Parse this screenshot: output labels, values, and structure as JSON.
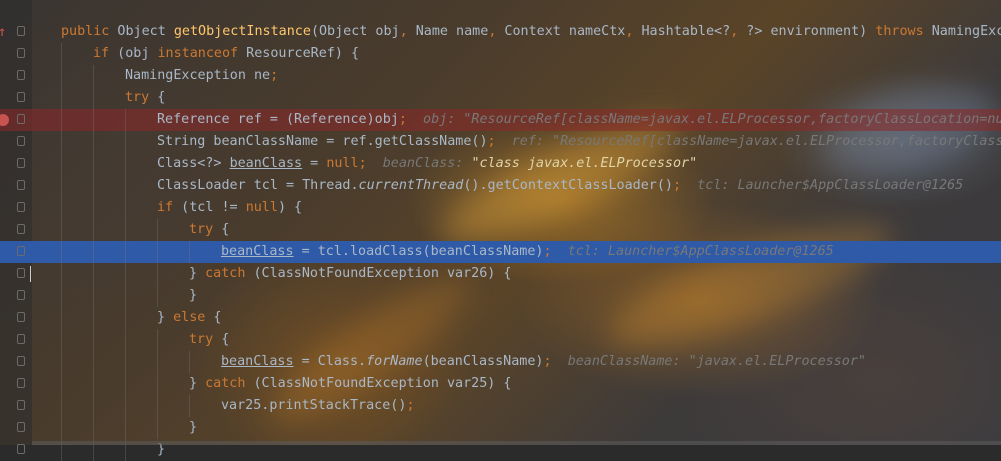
{
  "editor": {
    "lines": [
      {
        "indent": 0,
        "segments": [
          [
            "kw",
            "public"
          ],
          [
            "t",
            " Object "
          ],
          [
            "fn",
            "getObjectInstance"
          ],
          [
            "t",
            "(Object obj"
          ],
          [
            "kw",
            ","
          ],
          [
            "t",
            " Name name"
          ],
          [
            "kw",
            ","
          ],
          [
            "t",
            " Context nameCtx"
          ],
          [
            "kw",
            ","
          ],
          [
            "t",
            " Hashtable<?"
          ],
          [
            "kw",
            ","
          ],
          [
            "t",
            " ?> environment) "
          ],
          [
            "kw",
            "throws"
          ],
          [
            "t",
            " NamingExce"
          ]
        ]
      },
      {
        "indent": 1,
        "segments": [
          [
            "kw",
            "if"
          ],
          [
            "t",
            " (obj "
          ],
          [
            "kw",
            "instanceof"
          ],
          [
            "t",
            " ResourceRef) {"
          ]
        ]
      },
      {
        "indent": 2,
        "segments": [
          [
            "t",
            "NamingException ne"
          ],
          [
            "kw",
            ";"
          ]
        ]
      },
      {
        "indent": 2,
        "segments": [
          [
            "kw",
            "try"
          ],
          [
            "t",
            " {"
          ]
        ]
      },
      {
        "indent": 3,
        "segments": [
          [
            "t",
            "Reference ref = (Reference)obj"
          ],
          [
            "kw",
            ";"
          ],
          [
            "t",
            "  "
          ],
          [
            "hint",
            "obj: \"ResourceRef[className=javax.el.ELProcessor,factoryClassLocation=nu"
          ]
        ]
      },
      {
        "indent": 3,
        "segments": [
          [
            "t",
            "String beanClassName = ref.getClassName()"
          ],
          [
            "kw",
            ";"
          ],
          [
            "t",
            "  "
          ],
          [
            "hint",
            "ref: \"ResourceRef[className=javax.el.ELProcessor,factoryClass"
          ]
        ]
      },
      {
        "indent": 3,
        "segments": [
          [
            "t",
            "Class<?> "
          ],
          [
            "ul",
            "beanClass"
          ],
          [
            "t",
            " = "
          ],
          [
            "kw",
            "null"
          ],
          [
            "kw",
            ";"
          ],
          [
            "t",
            "  "
          ],
          [
            "hint",
            "beanClass: "
          ],
          [
            "str",
            "\"class javax.el.ELProcessor\""
          ]
        ]
      },
      {
        "indent": 3,
        "segments": [
          [
            "t",
            "ClassLoader tcl = Thread."
          ],
          [
            "it",
            "currentThread"
          ],
          [
            "t",
            "().getContextClassLoader()"
          ],
          [
            "kw",
            ";"
          ],
          [
            "t",
            "  "
          ],
          [
            "hint",
            "tcl: Launcher$AppClassLoader@1265"
          ]
        ]
      },
      {
        "indent": 3,
        "segments": [
          [
            "kw",
            "if"
          ],
          [
            "t",
            " (tcl != "
          ],
          [
            "kw",
            "null"
          ],
          [
            "t",
            ") {"
          ]
        ]
      },
      {
        "indent": 4,
        "segments": [
          [
            "kw",
            "try"
          ],
          [
            "t",
            " {"
          ]
        ]
      },
      {
        "indent": 5,
        "segments": [
          [
            "ul",
            "beanClass"
          ],
          [
            "t",
            " = tcl.loadClass(beanClassName)"
          ],
          [
            "kw",
            ";"
          ],
          [
            "t",
            "  "
          ],
          [
            "hint",
            "tcl: Launcher$AppClassLoader@1265"
          ]
        ]
      },
      {
        "indent": 4,
        "segments": [
          [
            "t",
            "} "
          ],
          [
            "kw",
            "catch"
          ],
          [
            "t",
            " (ClassNotFoundException var26) {"
          ]
        ]
      },
      {
        "indent": 4,
        "segments": [
          [
            "t",
            "}"
          ]
        ]
      },
      {
        "indent": 3,
        "segments": [
          [
            "t",
            "} "
          ],
          [
            "kw",
            "else"
          ],
          [
            "t",
            " {"
          ]
        ]
      },
      {
        "indent": 4,
        "segments": [
          [
            "kw",
            "try"
          ],
          [
            "t",
            " {"
          ]
        ]
      },
      {
        "indent": 5,
        "segments": [
          [
            "ul",
            "beanClass"
          ],
          [
            "t",
            " = Class."
          ],
          [
            "it",
            "forName"
          ],
          [
            "t",
            "(beanClassName)"
          ],
          [
            "kw",
            ";"
          ],
          [
            "t",
            "  "
          ],
          [
            "hint",
            "beanClassName: \"javax.el.ELProcessor\""
          ]
        ]
      },
      {
        "indent": 4,
        "segments": [
          [
            "t",
            "} "
          ],
          [
            "kw",
            "catch"
          ],
          [
            "t",
            " (ClassNotFoundException var25) {"
          ]
        ]
      },
      {
        "indent": 5,
        "segments": [
          [
            "t",
            "var25.printStackTrace()"
          ],
          [
            "kw",
            ";"
          ]
        ]
      },
      {
        "indent": 4,
        "segments": [
          [
            "t",
            "}"
          ]
        ]
      },
      {
        "indent": 3,
        "segments": [
          [
            "t",
            "}"
          ]
        ]
      }
    ],
    "error_line": 4,
    "current_line": 10,
    "colors": {
      "keyword": "#cc7832",
      "method": "#ffc66d",
      "text": "#a9b7c6",
      "hint": "#787878",
      "breakpoint": "#c75450",
      "current_line": "#2f5aa8"
    }
  }
}
